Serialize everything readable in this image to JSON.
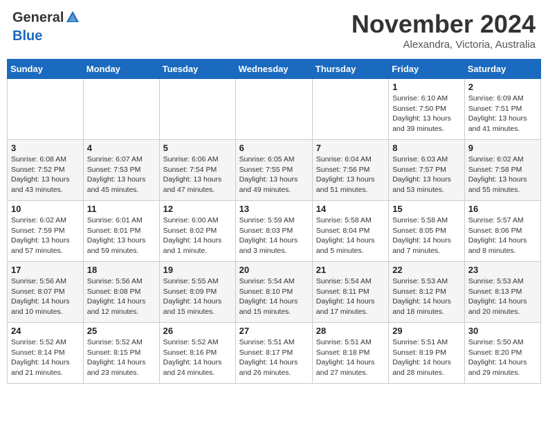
{
  "header": {
    "logo_general": "General",
    "logo_blue": "Blue",
    "month_title": "November 2024",
    "location": "Alexandra, Victoria, Australia"
  },
  "weekdays": [
    "Sunday",
    "Monday",
    "Tuesday",
    "Wednesday",
    "Thursday",
    "Friday",
    "Saturday"
  ],
  "weeks": [
    [
      {
        "day": "",
        "info": ""
      },
      {
        "day": "",
        "info": ""
      },
      {
        "day": "",
        "info": ""
      },
      {
        "day": "",
        "info": ""
      },
      {
        "day": "",
        "info": ""
      },
      {
        "day": "1",
        "info": "Sunrise: 6:10 AM\nSunset: 7:50 PM\nDaylight: 13 hours and 39 minutes."
      },
      {
        "day": "2",
        "info": "Sunrise: 6:09 AM\nSunset: 7:51 PM\nDaylight: 13 hours and 41 minutes."
      }
    ],
    [
      {
        "day": "3",
        "info": "Sunrise: 6:08 AM\nSunset: 7:52 PM\nDaylight: 13 hours and 43 minutes."
      },
      {
        "day": "4",
        "info": "Sunrise: 6:07 AM\nSunset: 7:53 PM\nDaylight: 13 hours and 45 minutes."
      },
      {
        "day": "5",
        "info": "Sunrise: 6:06 AM\nSunset: 7:54 PM\nDaylight: 13 hours and 47 minutes."
      },
      {
        "day": "6",
        "info": "Sunrise: 6:05 AM\nSunset: 7:55 PM\nDaylight: 13 hours and 49 minutes."
      },
      {
        "day": "7",
        "info": "Sunrise: 6:04 AM\nSunset: 7:56 PM\nDaylight: 13 hours and 51 minutes."
      },
      {
        "day": "8",
        "info": "Sunrise: 6:03 AM\nSunset: 7:57 PM\nDaylight: 13 hours and 53 minutes."
      },
      {
        "day": "9",
        "info": "Sunrise: 6:02 AM\nSunset: 7:58 PM\nDaylight: 13 hours and 55 minutes."
      }
    ],
    [
      {
        "day": "10",
        "info": "Sunrise: 6:02 AM\nSunset: 7:59 PM\nDaylight: 13 hours and 57 minutes."
      },
      {
        "day": "11",
        "info": "Sunrise: 6:01 AM\nSunset: 8:01 PM\nDaylight: 13 hours and 59 minutes."
      },
      {
        "day": "12",
        "info": "Sunrise: 6:00 AM\nSunset: 8:02 PM\nDaylight: 14 hours and 1 minute."
      },
      {
        "day": "13",
        "info": "Sunrise: 5:59 AM\nSunset: 8:03 PM\nDaylight: 14 hours and 3 minutes."
      },
      {
        "day": "14",
        "info": "Sunrise: 5:58 AM\nSunset: 8:04 PM\nDaylight: 14 hours and 5 minutes."
      },
      {
        "day": "15",
        "info": "Sunrise: 5:58 AM\nSunset: 8:05 PM\nDaylight: 14 hours and 7 minutes."
      },
      {
        "day": "16",
        "info": "Sunrise: 5:57 AM\nSunset: 8:06 PM\nDaylight: 14 hours and 8 minutes."
      }
    ],
    [
      {
        "day": "17",
        "info": "Sunrise: 5:56 AM\nSunset: 8:07 PM\nDaylight: 14 hours and 10 minutes."
      },
      {
        "day": "18",
        "info": "Sunrise: 5:56 AM\nSunset: 8:08 PM\nDaylight: 14 hours and 12 minutes."
      },
      {
        "day": "19",
        "info": "Sunrise: 5:55 AM\nSunset: 8:09 PM\nDaylight: 14 hours and 15 minutes."
      },
      {
        "day": "20",
        "info": "Sunrise: 5:54 AM\nSunset: 8:10 PM\nDaylight: 14 hours and 15 minutes."
      },
      {
        "day": "21",
        "info": "Sunrise: 5:54 AM\nSunset: 8:11 PM\nDaylight: 14 hours and 17 minutes."
      },
      {
        "day": "22",
        "info": "Sunrise: 5:53 AM\nSunset: 8:12 PM\nDaylight: 14 hours and 18 minutes."
      },
      {
        "day": "23",
        "info": "Sunrise: 5:53 AM\nSunset: 8:13 PM\nDaylight: 14 hours and 20 minutes."
      }
    ],
    [
      {
        "day": "24",
        "info": "Sunrise: 5:52 AM\nSunset: 8:14 PM\nDaylight: 14 hours and 21 minutes."
      },
      {
        "day": "25",
        "info": "Sunrise: 5:52 AM\nSunset: 8:15 PM\nDaylight: 14 hours and 23 minutes."
      },
      {
        "day": "26",
        "info": "Sunrise: 5:52 AM\nSunset: 8:16 PM\nDaylight: 14 hours and 24 minutes."
      },
      {
        "day": "27",
        "info": "Sunrise: 5:51 AM\nSunset: 8:17 PM\nDaylight: 14 hours and 26 minutes."
      },
      {
        "day": "28",
        "info": "Sunrise: 5:51 AM\nSunset: 8:18 PM\nDaylight: 14 hours and 27 minutes."
      },
      {
        "day": "29",
        "info": "Sunrise: 5:51 AM\nSunset: 8:19 PM\nDaylight: 14 hours and 28 minutes."
      },
      {
        "day": "30",
        "info": "Sunrise: 5:50 AM\nSunset: 8:20 PM\nDaylight: 14 hours and 29 minutes."
      }
    ]
  ]
}
